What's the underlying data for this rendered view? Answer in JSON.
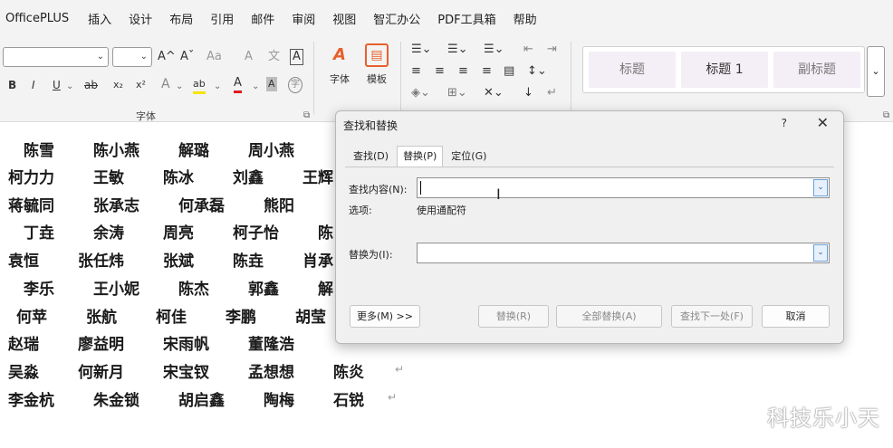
{
  "menu": {
    "brand": "OfficePLUS",
    "items": [
      "插入",
      "设计",
      "布局",
      "引用",
      "邮件",
      "审阅",
      "视图",
      "智汇办公",
      "PDF工具箱",
      "帮助"
    ]
  },
  "ribbon": {
    "font_group_label": "字体",
    "font_grow": "A^",
    "font_shrink": "Aˇ",
    "change_case": "Aa",
    "clear_format": "A",
    "phonetic": "文",
    "char_border": "A",
    "bold": "B",
    "italic": "I",
    "underline": "U",
    "strike": "ab",
    "subscript": "x₂",
    "superscript": "x²",
    "text_effect": "A",
    "highlight": "ab",
    "font_color": "A",
    "char_shade": "A",
    "enclose": "字",
    "font_btn_glyph": "A",
    "font_btn_label": "字体",
    "template_btn_glyph": "▤",
    "template_btn_label": "模板",
    "styles": [
      "标题",
      "标题 1",
      "副标题"
    ]
  },
  "document": {
    "rows": [
      [
        "陈雪",
        "陈小燕",
        "解璐",
        "周小燕"
      ],
      [
        "柯力力",
        "王敏",
        "陈冰",
        "刘鑫",
        "王辉"
      ],
      [
        "蒋毓同",
        "张承志",
        "何承磊",
        "熊阳"
      ],
      [
        "丁垚",
        "余涛",
        "周亮",
        "柯子怡",
        "陈"
      ],
      [
        "袁恒",
        "张任炜",
        "张斌",
        "陈垚",
        "肖承"
      ],
      [
        "李乐",
        "王小妮",
        "陈杰",
        "郭鑫",
        "解"
      ],
      [
        "何苹",
        "张航",
        "柯佳",
        "李鹏",
        "胡莹"
      ],
      [
        "赵瑞",
        "廖益明",
        "宋雨帆",
        "董隆浩"
      ],
      [
        "吴淼",
        "何新月",
        "宋宝钗",
        "孟想想",
        "陈炎"
      ],
      [
        "李金杭",
        "朱金锁",
        "胡启鑫",
        "陶梅",
        "石锐"
      ]
    ],
    "paragraph_mark": "↵",
    "watermark": "科技乐小天"
  },
  "dialog": {
    "title": "查找和替换",
    "help": "?",
    "close": "✕",
    "tabs": [
      "查找(D)",
      "替换(P)",
      "定位(G)"
    ],
    "find_label": "查找内容(N):",
    "find_value": "",
    "options_label": "选项:",
    "options_value": "使用通配符",
    "replace_label": "替换为(I):",
    "replace_value": "",
    "buttons": {
      "more": "更多(M) >>",
      "replace": "替换(R)",
      "replace_all": "全部替换(A)",
      "find_next": "查找下一处(F)",
      "cancel": "取消"
    }
  }
}
